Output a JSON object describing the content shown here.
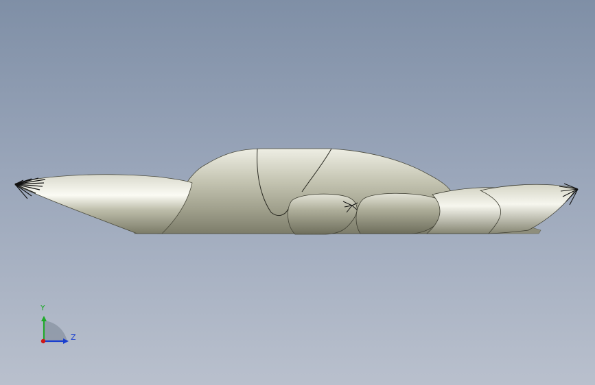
{
  "viewport": {
    "background_top": "#7f8fa6",
    "background_bottom": "#b9c0cd",
    "model_color": "#c9c9b9"
  },
  "triad": {
    "y_label": "Y",
    "z_label": "Z",
    "y_color": "#1faa2a",
    "z_color": "#1a3fcf",
    "x_color": "#d01818"
  }
}
